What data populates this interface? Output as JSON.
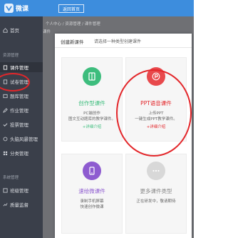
{
  "app": {
    "name": "微课"
  },
  "topbar": {
    "back_button": "返回首页"
  },
  "sidebar": {
    "home": "首页",
    "group_resources": "资源管理",
    "items": [
      "课件管理",
      "试卷管理",
      "题库管理",
      "作业管理",
      "投票管理",
      "头脑风暴管理",
      "分类管理"
    ],
    "group_system": "系统管理",
    "items2": [
      "班级管理",
      "质量监督"
    ]
  },
  "main": {
    "breadcrumb": "个人中心 / 资源管理 / 课件管理",
    "tab": "课件"
  },
  "modal": {
    "title": "创建新课件",
    "subtitle": "请选择一种类型创建课件",
    "cards": [
      {
        "title": "创作型课件",
        "desc1": "PC端创作",
        "desc2": "图文互动题库的教学课件。",
        "link": "+详细介绍"
      },
      {
        "title": "PPT语音课件",
        "desc1": "上传PPT",
        "desc2": "一键生成PPT教学课件。",
        "link": "+详细介绍"
      },
      {
        "title": "速绘微课件",
        "desc1": "录制手机屏幕",
        "desc2": "快速创作微课"
      },
      {
        "title": "更多课件类型",
        "desc1": "正在研发中，敬请期待"
      }
    ]
  },
  "colors": {
    "topbar": "#3d8ddd",
    "sidebar": "#3a3f4a",
    "green": "#3dbd7d",
    "red": "#e3262a",
    "purple": "#8e5bd0",
    "grey_icon": "#d8d8d8"
  }
}
